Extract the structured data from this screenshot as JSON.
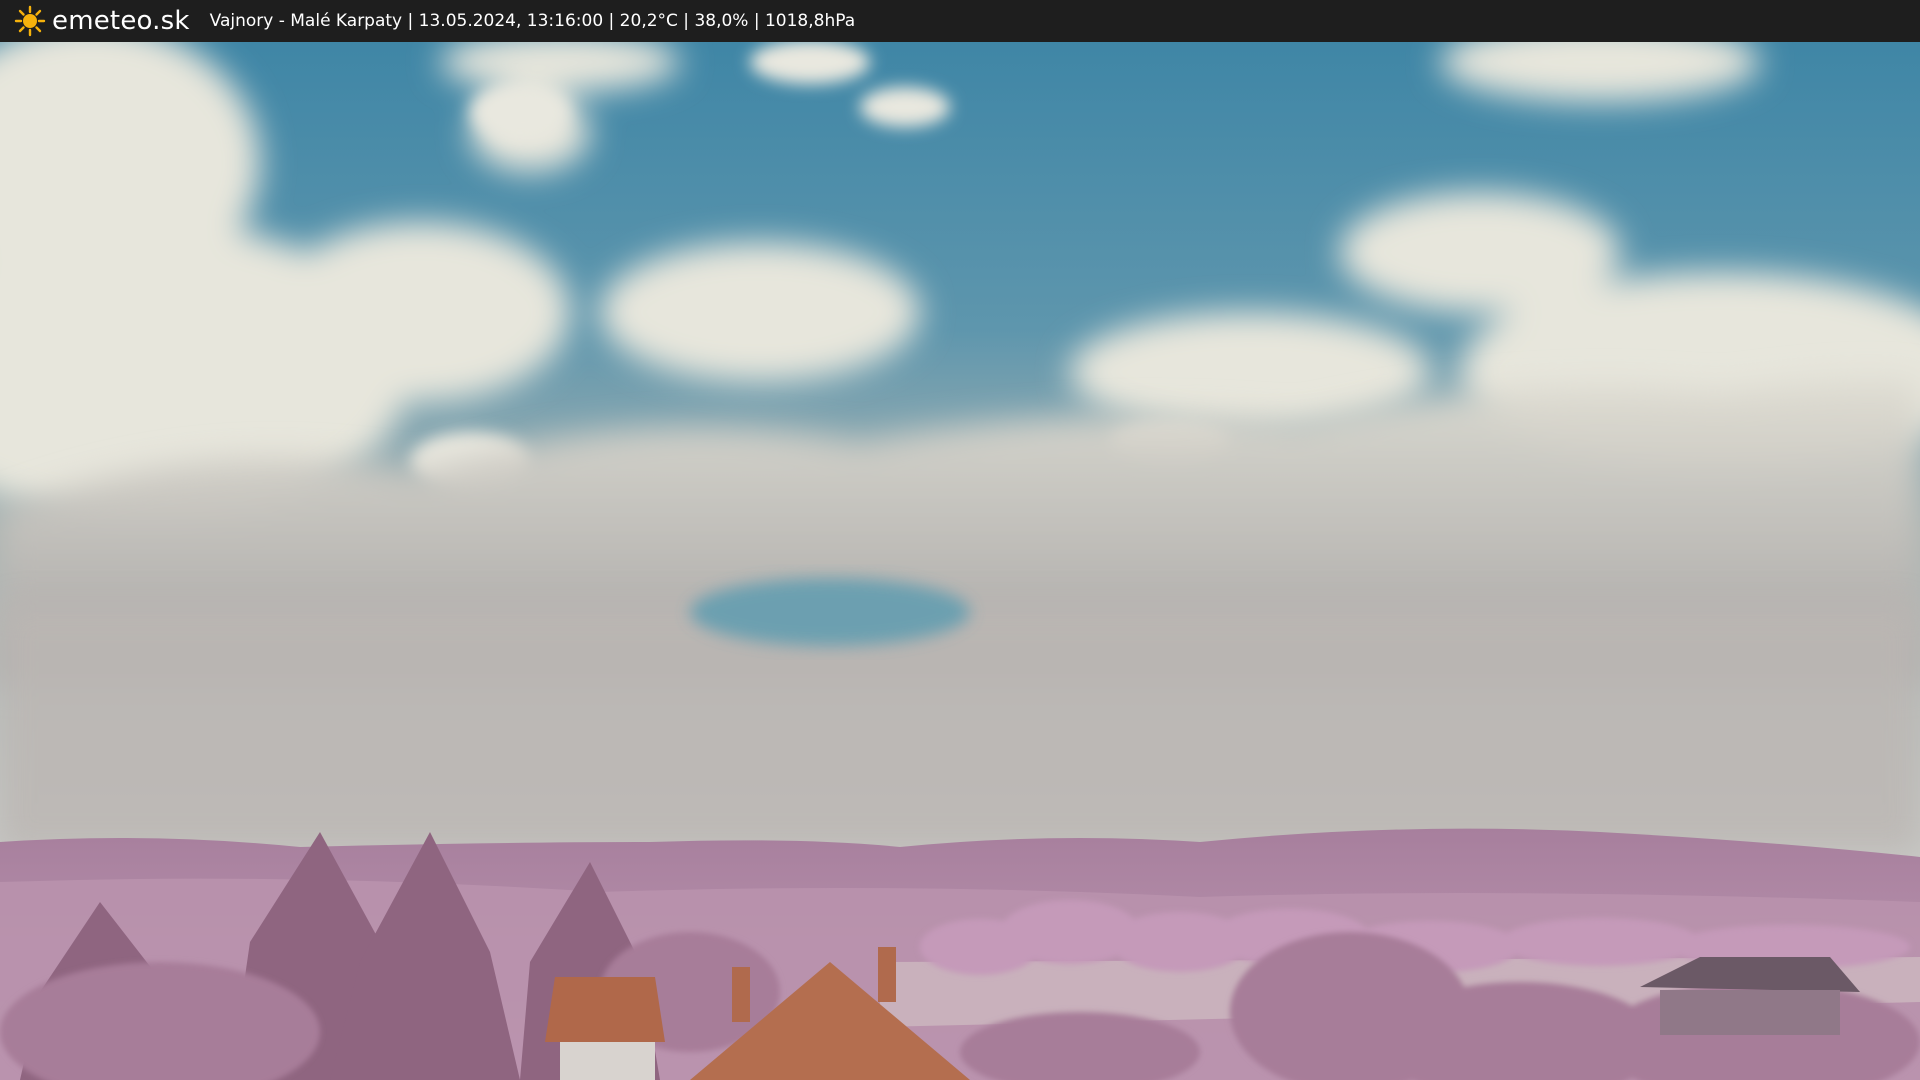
{
  "overlay": {
    "brand": "emeteo.sk",
    "logo_icon": "sun-icon",
    "caption": "Vajnory - Malé Karpaty | 13.05.2024, 13:16:00 | 20,2°C | 38,0% | 1018,8hPa"
  },
  "colors": {
    "bar_background": "#1e1e1e",
    "sun": "#f6b20c",
    "sky_blue": "#4e8fad",
    "cloud_white": "#e6e6de",
    "vegetation_pink": "#b98aa8",
    "roof_tile": "#b0684a"
  }
}
